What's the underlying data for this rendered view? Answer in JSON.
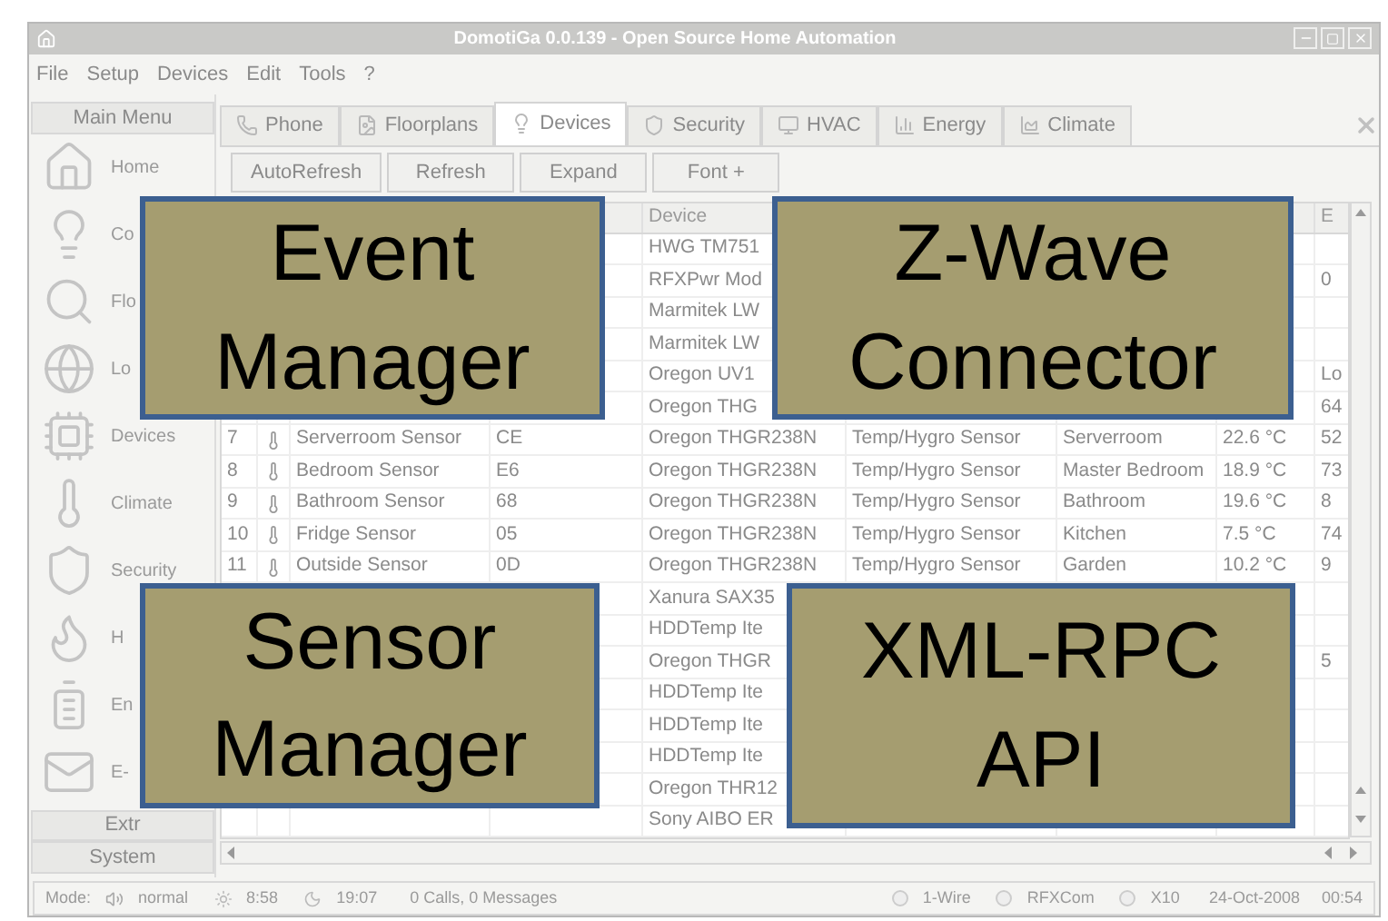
{
  "window": {
    "title": "DomotiGa 0.0.139 - Open Source Home Automation"
  },
  "menu": [
    "File",
    "Setup",
    "Devices",
    "Edit",
    "Tools",
    "?"
  ],
  "sidebar": {
    "header": "Main Menu",
    "items": [
      {
        "label": "Home"
      },
      {
        "label": "Co"
      },
      {
        "label": "Flo"
      },
      {
        "label": "Lo"
      },
      {
        "label": "Devices"
      },
      {
        "label": "Climate"
      },
      {
        "label": "Security"
      },
      {
        "label": "H"
      },
      {
        "label": "En"
      },
      {
        "label": "E-"
      }
    ],
    "sections": [
      "Extr",
      "System"
    ]
  },
  "tabs": [
    {
      "label": "Phone",
      "selected": false
    },
    {
      "label": "Floorplans",
      "selected": false
    },
    {
      "label": "Devices",
      "selected": true
    },
    {
      "label": "Security",
      "selected": false
    },
    {
      "label": "HVAC",
      "selected": false
    },
    {
      "label": "Energy",
      "selected": false
    },
    {
      "label": "Climate",
      "selected": false
    }
  ],
  "toolbar": [
    "AutoRefresh",
    "Refresh",
    "Expand",
    "Font +"
  ],
  "table": {
    "header": {
      "device": "Device",
      "e": "E"
    },
    "rows": [
      {
        "device": "HWG TM751"
      },
      {
        "device": "RFXPwr Mod",
        "e": "0"
      },
      {
        "device": "Marmitek LW"
      },
      {
        "device": "Marmitek LW"
      },
      {
        "device": "Oregon UV1",
        "e": "Lo"
      },
      {
        "device": "Oregon THG",
        "e": "64"
      },
      {
        "id": "7",
        "name": "Serverroom Sensor",
        "address": "CE",
        "device": "Oregon THGR238N",
        "type": "Temp/Hygro Sensor",
        "location": "Serverroom",
        "value": "22.6 °C",
        "e": "52"
      },
      {
        "id": "8",
        "name": "Bedroom Sensor",
        "address": "E6",
        "device": "Oregon THGR238N",
        "type": "Temp/Hygro Sensor",
        "location": "Master Bedroom",
        "value": "18.9 °C",
        "e": "73"
      },
      {
        "id": "9",
        "name": "Bathroom Sensor",
        "address": "68",
        "device": "Oregon THGR238N",
        "type": "Temp/Hygro Sensor",
        "location": "Bathroom",
        "value": "19.6 °C",
        "e": "8"
      },
      {
        "id": "10",
        "name": "Fridge Sensor",
        "address": "05",
        "device": "Oregon THGR238N",
        "type": "Temp/Hygro Sensor",
        "location": "Kitchen",
        "value": "7.5 °C",
        "e": "74"
      },
      {
        "id": "11",
        "name": "Outside Sensor",
        "address": "0D",
        "device": "Oregon THGR238N",
        "type": "Temp/Hygro Sensor",
        "location": "Garden",
        "value": "10.2 °C",
        "e": "9"
      },
      {
        "device": "Xanura SAX35"
      },
      {
        "device": "HDDTemp Ite"
      },
      {
        "device": "Oregon THGR",
        "e": "5"
      },
      {
        "device": "HDDTemp Ite"
      },
      {
        "device": "HDDTemp Ite"
      },
      {
        "device": "HDDTemp Ite"
      },
      {
        "device": "Oregon THR12"
      },
      {
        "device": "Sony AIBO ER"
      }
    ]
  },
  "feature_overlays": [
    {
      "text": "Event\nManager"
    },
    {
      "text": "Z-Wave\nConnector"
    },
    {
      "text": "Sensor\nManager"
    },
    {
      "text": "XML-RPC\nAPI"
    }
  ],
  "status_bar": {
    "mode_label": "Mode:",
    "mode": "normal",
    "sunrise": "8:58",
    "sunset": "19:07",
    "messages": "0 Calls, 0 Messages",
    "interfaces": [
      {
        "label": "1-Wire"
      },
      {
        "label": "RFXCom"
      },
      {
        "label": "X10"
      }
    ],
    "date": "24-Oct-2008",
    "time": "00:54"
  }
}
